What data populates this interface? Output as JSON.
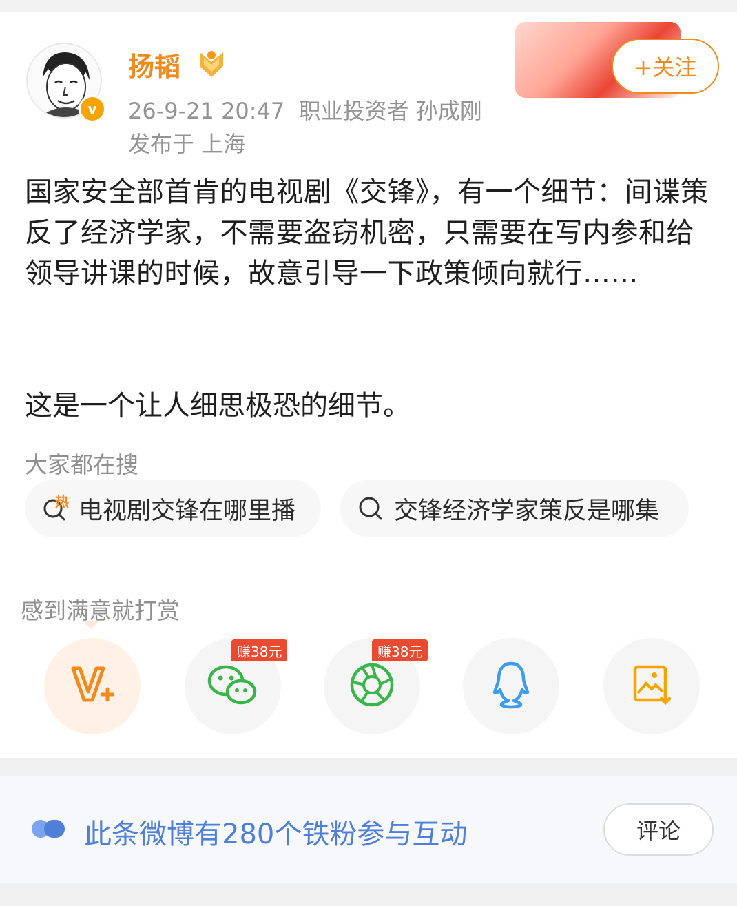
{
  "post": {
    "username": "扬韬",
    "timestamp": "26-9-21 20:47",
    "source": "职业投资者 孙成刚",
    "location": "发布于 上海",
    "follow_label": "+关注",
    "verified_symbol": "v",
    "text_paragraph1": "国家安全部首肯的电视剧《交锋》，有一个细节：间谍策反了经济学家，不需要盗窃机密，只需要在写内参和给领导讲课的时候，故意引导一下政策倾向就行……",
    "text_paragraph2": "这是一个让人细思极恐的细节。"
  },
  "search": {
    "heading": "大家都在搜",
    "chips": [
      {
        "label": "电视剧交锋在哪里播",
        "icon": "hot-search-icon",
        "hot_mark": "热"
      },
      {
        "label": "交锋经济学家策反是哪集",
        "icon": "search-icon"
      }
    ]
  },
  "reward": {
    "heading": "感到满意就打赏",
    "share_buttons": [
      {
        "name": "v-plus",
        "icon": "v-plus-icon"
      },
      {
        "name": "wechat",
        "icon": "wechat-icon",
        "badge": "赚38元"
      },
      {
        "name": "moments",
        "icon": "moments-icon",
        "badge": "赚38元"
      },
      {
        "name": "qq",
        "icon": "qq-icon"
      },
      {
        "name": "save-image",
        "icon": "save-image-icon"
      }
    ]
  },
  "footer": {
    "text": "此条微博有280个铁粉参与互动",
    "comment_label": "评论"
  },
  "colors": {
    "brand_orange": "#f08a1c",
    "link_blue": "#4f7fd8",
    "wechat_green": "#3ab54a",
    "qq_blue": "#3c9cf0",
    "badge_red": "#ea4a30"
  }
}
